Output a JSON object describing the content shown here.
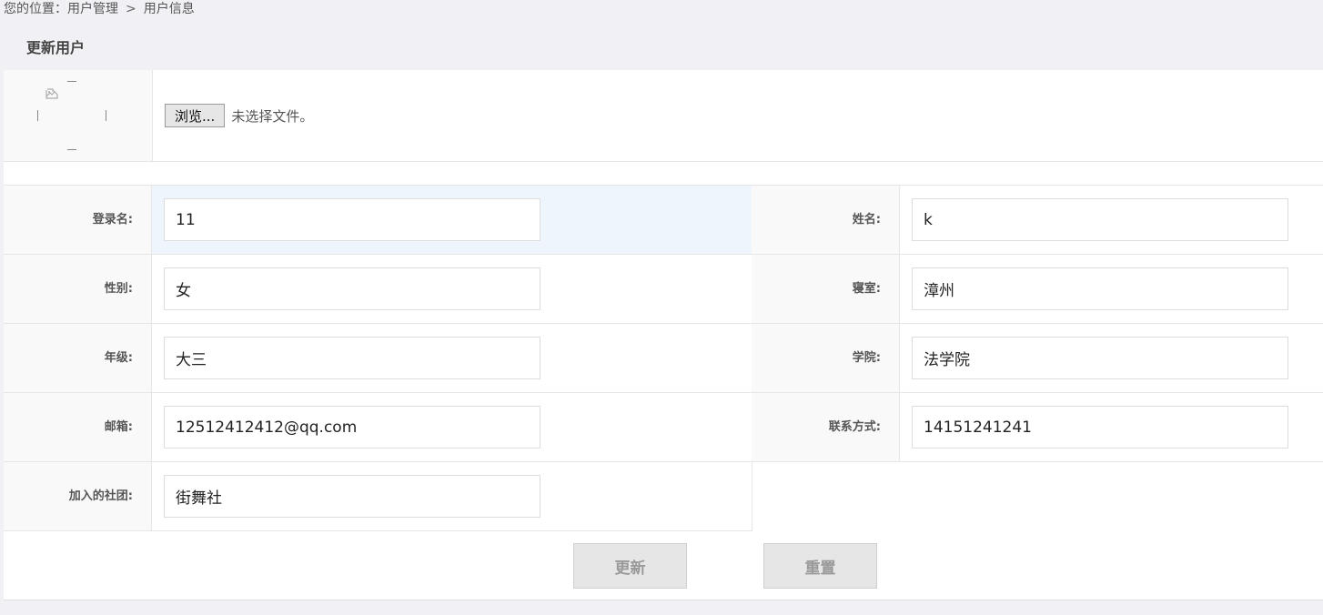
{
  "breadcrumb": {
    "prefix": "您的位置：",
    "level1": "用户管理",
    "separator": ">",
    "level2": "用户信息"
  },
  "page_title": "更新用户",
  "avatar": {
    "icon": "broken-image-icon"
  },
  "file_upload": {
    "button_label": "浏览...",
    "status_text": "未选择文件。"
  },
  "form": {
    "login_name": {
      "label": "登录名:",
      "value": "11"
    },
    "real_name": {
      "label": "姓名:",
      "value": "k"
    },
    "gender": {
      "label": "性别:",
      "value": "女"
    },
    "dorm": {
      "label": "寝室:",
      "value": "漳州"
    },
    "grade": {
      "label": "年级:",
      "value": "大三"
    },
    "college": {
      "label": "学院:",
      "value": "法学院"
    },
    "email": {
      "label": "邮箱:",
      "value": "12512412412@qq.com"
    },
    "phone": {
      "label": "联系方式:",
      "value": "14151241241"
    },
    "clubs": {
      "label": "加入的社团:",
      "value": "街舞社"
    }
  },
  "actions": {
    "update_label": "更新",
    "reset_label": "重置"
  },
  "colors": {
    "page_bg": "#f1f0f4",
    "label_bg": "#f9f9f9",
    "active_row_bg": "#eef5fc",
    "border": "#e6e6e6",
    "button_bg": "#e6e6e6",
    "button_text": "#999999"
  }
}
